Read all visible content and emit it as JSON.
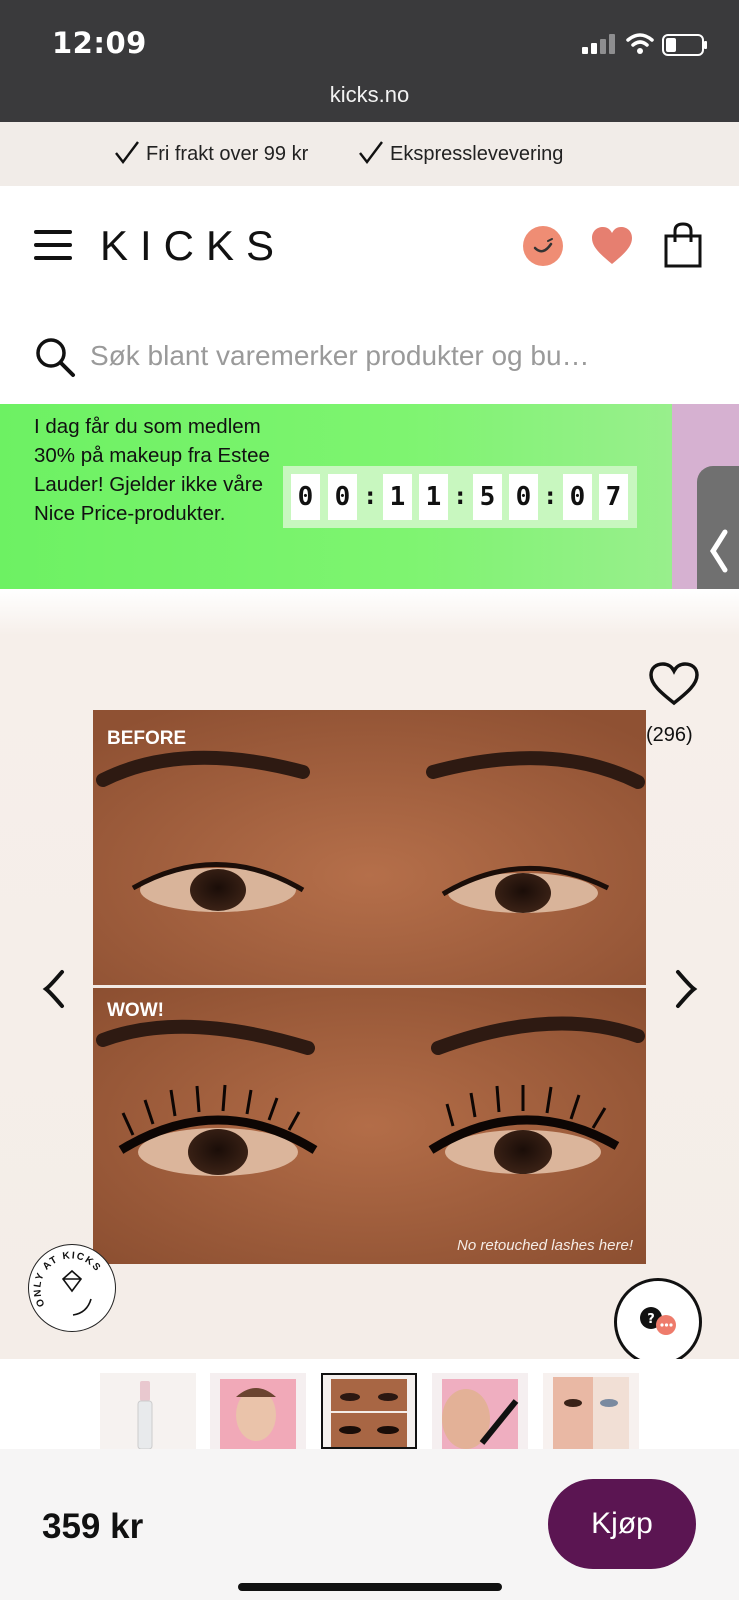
{
  "status_bar": {
    "time": "12:09",
    "url": "kicks.no"
  },
  "benefits": [
    "Fri frakt over 99 kr",
    "Ekspresslevevering"
  ],
  "header": {
    "logo": "KICKS"
  },
  "search": {
    "placeholder": "Søk blant varemerker produkter og bu…"
  },
  "promo": {
    "text": "I dag får du som medlem 30% på makeup fra Estee Lauder! Gjelder ikke våre Nice Price-produkter.",
    "countdown": [
      "0",
      "0",
      ":",
      "1",
      "1",
      ":",
      "5",
      "0",
      ":",
      "0",
      "7"
    ]
  },
  "product": {
    "favorite_count": "(296)",
    "image_labels": {
      "before": "BEFORE",
      "after": "WOW!",
      "caption": "No retouched lashes here!"
    },
    "badge_text": "ONLY AT KICKS",
    "price": "359 kr",
    "buy_label": "Kjøp",
    "thumbnails": [
      "mascara-tube",
      "model-face",
      "before-after-eyes",
      "applying-mascara",
      "eye-closeup"
    ],
    "selected_thumbnail": 2
  },
  "icons": {
    "menu": "hamburger-icon",
    "account": "smile-icon",
    "wishlist": "heart-icon",
    "cart": "shopping-bag-icon",
    "search": "search-icon",
    "chat": "chat-help-icon"
  },
  "colors": {
    "promo_green": "#6df163",
    "buy_purple": "#5b1552",
    "accent_coral": "#ef8d74"
  }
}
